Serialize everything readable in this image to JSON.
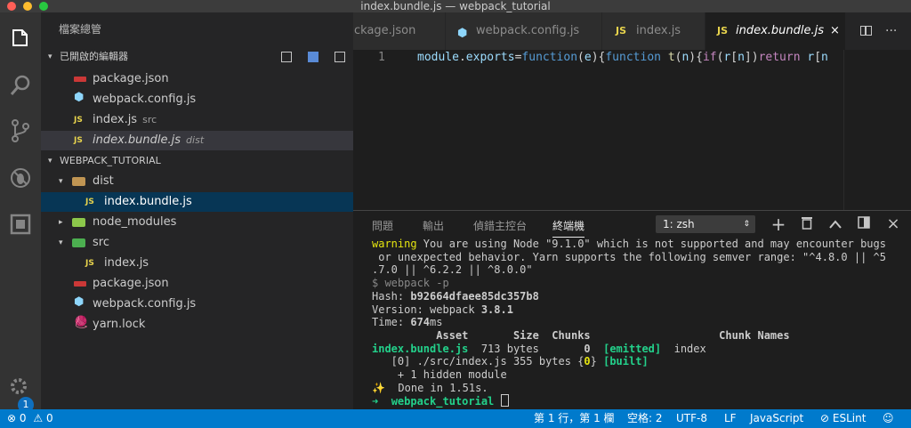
{
  "window": {
    "title": "index.bundle.js — webpack_tutorial",
    "traffic_colors": [
      "#ff5f57",
      "#febc2e",
      "#28c840"
    ]
  },
  "activity": {
    "icons": [
      "files-icon",
      "search-icon",
      "source-control-icon",
      "debug-icon",
      "extensions-icon",
      "gear-icon"
    ],
    "badge": "1"
  },
  "sidebar": {
    "title": "檔案總管",
    "open_editors_title": "已開啟的編輯器",
    "open_editors": [
      {
        "icon": "npm",
        "label": "package.json",
        "hint": ""
      },
      {
        "icon": "webpack",
        "label": "webpack.config.js",
        "hint": ""
      },
      {
        "icon": "js",
        "label": "index.js",
        "hint": "src"
      },
      {
        "icon": "js",
        "label": "index.bundle.js",
        "hint": "dist"
      }
    ],
    "project_title": "WEBPACK_TUTORIAL",
    "tree": [
      {
        "icon": "folder-dist",
        "label": "dist",
        "twisty": "▾"
      },
      {
        "icon": "js",
        "label": "index.bundle.js"
      },
      {
        "icon": "folder-node",
        "label": "node_modules",
        "twisty": "▸"
      },
      {
        "icon": "folder-src",
        "label": "src",
        "twisty": "▾"
      },
      {
        "icon": "js",
        "label": "index.js"
      },
      {
        "icon": "npm",
        "label": "package.json"
      },
      {
        "icon": "webpack",
        "label": "webpack.config.js"
      },
      {
        "icon": "yarn",
        "label": "yarn.lock"
      }
    ]
  },
  "tabs": [
    {
      "icon": "npm",
      "label": "package.json",
      "shown": "ckage.json"
    },
    {
      "icon": "webpack",
      "label": "webpack.config.js"
    },
    {
      "icon": "js",
      "label": "index.js"
    },
    {
      "icon": "js",
      "label": "index.bundle.js",
      "close": "×"
    }
  ],
  "editor": {
    "line_number": "1",
    "tokens": [
      {
        "t": "module",
        "c": "#9cdcfe"
      },
      {
        "t": ".",
        "c": "#d4d4d4"
      },
      {
        "t": "exports",
        "c": "#9cdcfe"
      },
      {
        "t": "=",
        "c": "#d4d4d4"
      },
      {
        "t": "function",
        "c": "#569cd6"
      },
      {
        "t": "(",
        "c": "#d4d4d4"
      },
      {
        "t": "e",
        "c": "#9cdcfe"
      },
      {
        "t": "){",
        "c": "#d4d4d4"
      },
      {
        "t": "function",
        "c": "#569cd6"
      },
      {
        "t": " ",
        "c": "#d4d4d4"
      },
      {
        "t": "t",
        "c": "#dcdcaa"
      },
      {
        "t": "(",
        "c": "#d4d4d4"
      },
      {
        "t": "n",
        "c": "#9cdcfe"
      },
      {
        "t": "){",
        "c": "#d4d4d4"
      },
      {
        "t": "if",
        "c": "#c586c0"
      },
      {
        "t": "(",
        "c": "#d4d4d4"
      },
      {
        "t": "r",
        "c": "#9cdcfe"
      },
      {
        "t": "[",
        "c": "#d4d4d4"
      },
      {
        "t": "n",
        "c": "#9cdcfe"
      },
      {
        "t": "])",
        "c": "#d4d4d4"
      },
      {
        "t": "return",
        "c": "#c586c0"
      },
      {
        "t": " ",
        "c": "#d4d4d4"
      },
      {
        "t": "r",
        "c": "#9cdcfe"
      },
      {
        "t": "[",
        "c": "#d4d4d4"
      },
      {
        "t": "n",
        "c": "#9cdcfe"
      }
    ]
  },
  "panel": {
    "tabs": [
      "問題",
      "輸出",
      "偵錯主控台",
      "終端機"
    ],
    "terminal_select": "1: zsh",
    "buttons": {
      "add": "+",
      "trash": "🗑",
      "maximize": "^",
      "split": "◫",
      "close": "×"
    },
    "lines": [
      [
        {
          "t": "warning",
          "c": "y"
        },
        {
          "t": " You are using Node \"9.1.0\" which is not supported and may encounter bugs"
        }
      ],
      [
        {
          "t": " or unexpected behavior. Yarn supports the following semver range: \"^4.8.0 || ^5"
        }
      ],
      [
        {
          "t": ".7.0 || ^6.2.2 || ^8.0.0\""
        }
      ],
      [
        {
          "t": "$ webpack -p",
          "c": "gr"
        }
      ],
      [
        {
          "t": "Hash: "
        },
        {
          "t": "b92664dfaee85dc357b8",
          "c": "b"
        }
      ],
      [
        {
          "t": "Version: webpack "
        },
        {
          "t": "3.8.1",
          "c": "b"
        }
      ],
      [
        {
          "t": "Time: "
        },
        {
          "t": "674",
          "c": "b"
        },
        {
          "t": "ms"
        }
      ],
      [
        {
          "t": "          Asset       Size  Chunks                    Chunk Names",
          "c": "b"
        }
      ],
      [
        {
          "t": "index.bundle.js",
          "c": "g b"
        },
        {
          "t": "  713 bytes       "
        },
        {
          "t": "0",
          "c": "b"
        },
        {
          "t": "  "
        },
        {
          "t": "[emitted]",
          "c": "g b"
        },
        {
          "t": "  index"
        }
      ],
      [
        {
          "t": "   [0] ./src/index.js 355 bytes {"
        },
        {
          "t": "0",
          "c": "y b"
        },
        {
          "t": "} "
        },
        {
          "t": "[built]",
          "c": "g b"
        }
      ],
      [
        {
          "t": "    + 1 hidden module"
        }
      ],
      [
        {
          "t": "✨",
          "c": "y"
        },
        {
          "t": "  Done in 1.51s."
        }
      ],
      [
        {
          "t": "➜",
          "c": "g"
        },
        {
          "t": "  "
        },
        {
          "t": "webpack_tutorial",
          "c": "g b"
        },
        {
          "t": " "
        },
        {
          "t": "",
          "cursor": true
        }
      ]
    ]
  },
  "status": {
    "errors": "0",
    "warnings": "0",
    "position": "第 1 行，第 1 欄",
    "spaces": "空格: 2",
    "encoding": "UTF-8",
    "eol": "LF",
    "language": "JavaScript",
    "eslint": "ESLint"
  }
}
